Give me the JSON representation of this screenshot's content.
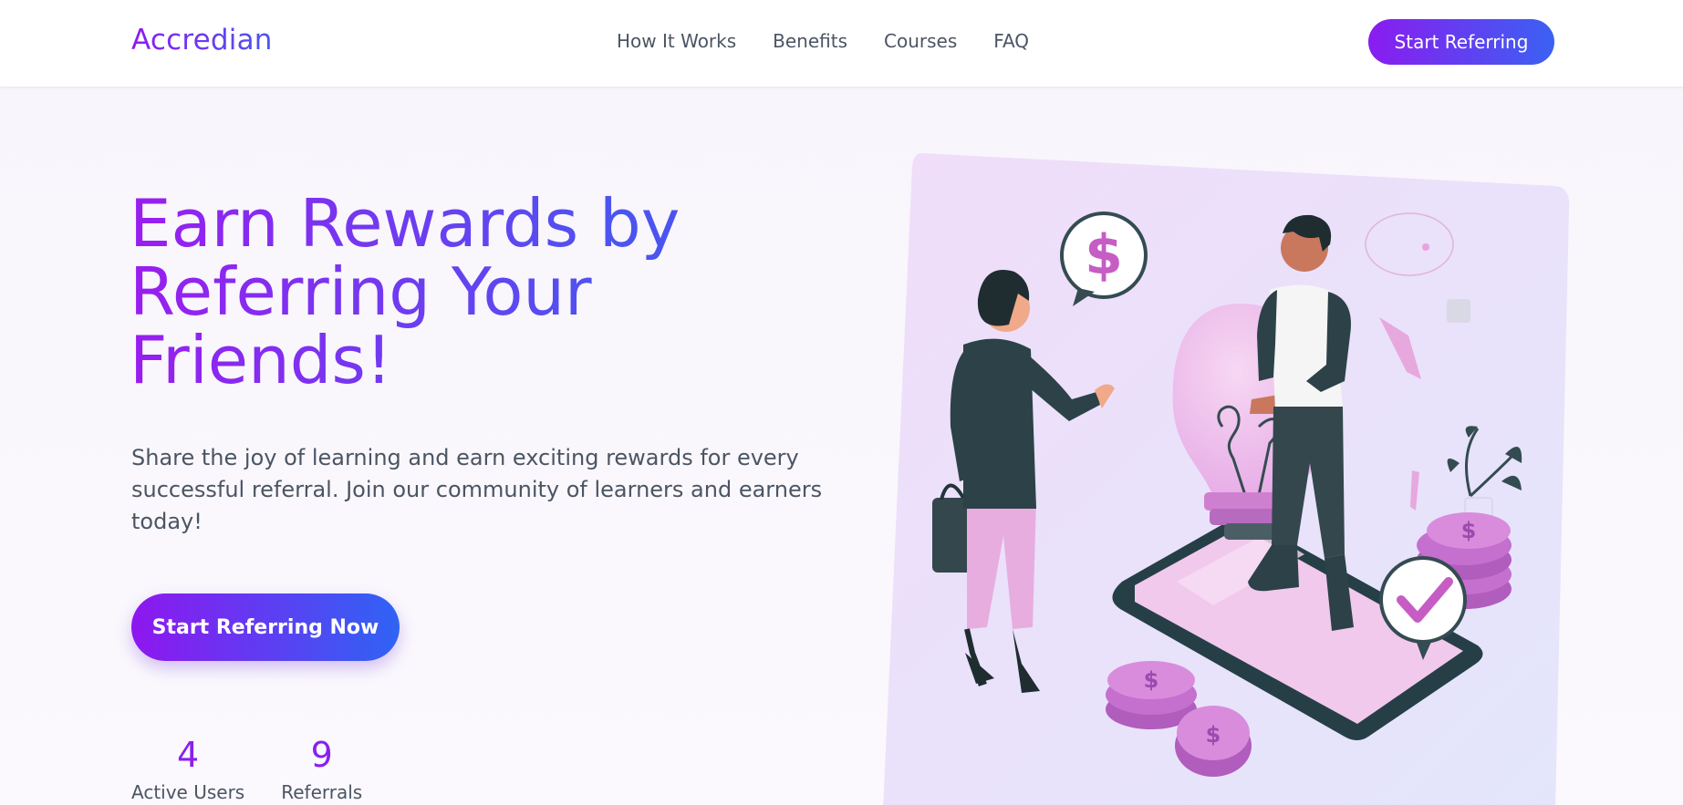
{
  "header": {
    "logo": "Accredian",
    "nav": [
      {
        "label": "How It Works"
      },
      {
        "label": "Benefits"
      },
      {
        "label": "Courses"
      },
      {
        "label": "FAQ"
      }
    ],
    "cta": "Start Referring"
  },
  "hero": {
    "title": "Earn Rewards by Referring Your Friends!",
    "subtitle": "Share the joy of learning and earn exciting rewards for every successful referral. Join our community of learners and earners today!",
    "cta": "Start Referring Now",
    "stats": [
      {
        "value": "4",
        "label": "Active Users"
      },
      {
        "value": "9",
        "label": "Referrals"
      }
    ]
  },
  "illustration": {
    "coin_symbol": "$",
    "icons": [
      "dollar-speech-bubble-icon",
      "lightbulb-icon",
      "smartphone-icon",
      "coin-stack-icon",
      "checkmark-bubble-icon",
      "thumbs-up-icon",
      "plant-icon"
    ]
  },
  "colors": {
    "brand_purple": "#8e1cf0",
    "brand_blue": "#3b61f2",
    "accent_pink": "#c66bd3"
  }
}
